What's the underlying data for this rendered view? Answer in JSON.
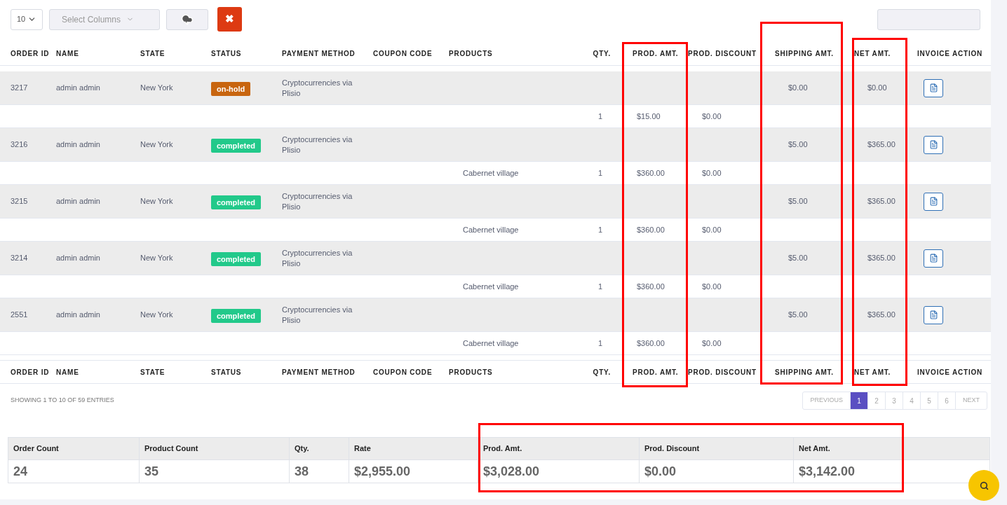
{
  "toolbar": {
    "page_length": "10",
    "columns_select": {
      "placeholder": "Select Columns"
    },
    "clear_button": "✖"
  },
  "table": {
    "columns": [
      "ORDER ID",
      "NAME",
      "STATE",
      "STATUS",
      "PAYMENT METHOD",
      "COUPON CODE",
      "PRODUCTS",
      "QTY.",
      "PROD. AMT.",
      "PROD. DISCOUNT",
      "SHIPPING AMT.",
      "NET AMT.",
      "INVOICE ACTION"
    ],
    "rows": [
      {
        "kind": "order",
        "order_id": "3217",
        "name": "admin admin",
        "state": "New York",
        "status": {
          "label": "on-hold",
          "kind": "on-hold"
        },
        "payment_method": "Cryptocurrencies via Plisio",
        "shipping_amt": "$0.00",
        "net_amt": "$0.00"
      },
      {
        "kind": "item",
        "qty": "1",
        "prod_amt": "$15.00",
        "prod_discount": "$0.00"
      },
      {
        "kind": "order",
        "order_id": "3216",
        "name": "admin admin",
        "state": "New York",
        "status": {
          "label": "completed",
          "kind": "completed"
        },
        "payment_method": "Cryptocurrencies via Plisio",
        "shipping_amt": "$5.00",
        "net_amt": "$365.00"
      },
      {
        "kind": "item",
        "product": "Cabernet village",
        "qty": "1",
        "prod_amt": "$360.00",
        "prod_discount": "$0.00"
      },
      {
        "kind": "order",
        "order_id": "3215",
        "name": "admin admin",
        "state": "New York",
        "status": {
          "label": "completed",
          "kind": "completed"
        },
        "payment_method": "Cryptocurrencies via Plisio",
        "shipping_amt": "$5.00",
        "net_amt": "$365.00"
      },
      {
        "kind": "item",
        "product": "Cabernet village",
        "qty": "1",
        "prod_amt": "$360.00",
        "prod_discount": "$0.00"
      },
      {
        "kind": "order",
        "order_id": "3214",
        "name": "admin admin",
        "state": "New York",
        "status": {
          "label": "completed",
          "kind": "completed"
        },
        "payment_method": "Cryptocurrencies via Plisio",
        "shipping_amt": "$5.00",
        "net_amt": "$365.00"
      },
      {
        "kind": "item",
        "product": "Cabernet village",
        "qty": "1",
        "prod_amt": "$360.00",
        "prod_discount": "$0.00"
      },
      {
        "kind": "order",
        "order_id": "2551",
        "name": "admin admin",
        "state": "New York",
        "status": {
          "label": "completed",
          "kind": "completed"
        },
        "payment_method": "Cryptocurrencies via Plisio",
        "shipping_amt": "$5.00",
        "net_amt": "$365.00"
      },
      {
        "kind": "item",
        "product": "Cabernet village",
        "qty": "1",
        "prod_amt": "$360.00",
        "prod_discount": "$0.00"
      }
    ],
    "footer_columns": [
      "ORDER ID",
      "NAME",
      "STATE",
      "STATUS",
      "PAYMENT METHOD",
      "COUPON CODE",
      "PRODUCTS",
      "QTY.",
      "PROD. AMT.",
      "PROD. DISCOUNT",
      "SHIPPING AMT.",
      "NET AMT.",
      "INVOICE ACTION"
    ]
  },
  "info": "SHOWING 1 TO 10 OF 59 ENTRIES",
  "pagination": {
    "previous": "PREVIOUS",
    "pages": [
      {
        "label": "1",
        "selected": true
      },
      {
        "label": "2",
        "selected": false
      },
      {
        "label": "3",
        "selected": false
      },
      {
        "label": "4",
        "selected": false
      },
      {
        "label": "5",
        "selected": false
      },
      {
        "label": "6",
        "selected": false
      }
    ],
    "next": "NEXT"
  },
  "summary": [
    {
      "label": "Order Count",
      "value": "24"
    },
    {
      "label": "Product Count",
      "value": "35"
    },
    {
      "label": "Qty.",
      "value": "38"
    },
    {
      "label": "Rate",
      "value": "$2,955.00"
    },
    {
      "label": "Prod. Amt.",
      "value": "$3,028.00"
    },
    {
      "label": "Prod. Discount",
      "value": "$0.00"
    },
    {
      "label": "Net Amt.",
      "value": "$3,142.00"
    }
  ]
}
